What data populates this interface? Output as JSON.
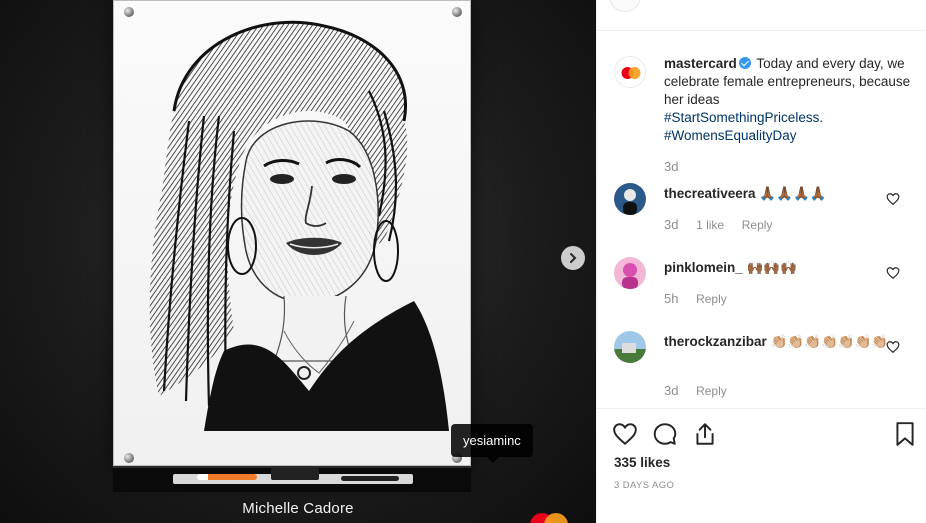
{
  "media": {
    "caption": "Michelle Cadore",
    "tag_label": "yesiaminc",
    "next_icon": "chevron-right-icon"
  },
  "post": {
    "author": "mastercard",
    "caption_text": "Today and every day, we celebrate female entrepreneurs, because her ideas",
    "hashtags": [
      "#StartSomethingPriceless.",
      "#WomensEqualityDay"
    ],
    "time": "3d"
  },
  "comments": [
    {
      "user": "thecreativeera",
      "emoji": "🙏🏾🙏🏾🙏🏾🙏🏾",
      "time": "3d",
      "likes": "1 like",
      "reply": "Reply"
    },
    {
      "user": "pinklomein_",
      "emoji": "🙌🏾🙌🏾🙌🏾",
      "time": "5h",
      "reply": "Reply"
    },
    {
      "user": "therockzanzibar",
      "emoji": "👏🏼👏🏼👏🏼👏🏼👏🏼👏🏼👏🏼",
      "time": "3d",
      "reply": "Reply"
    }
  ],
  "actions": {
    "like_icon": "heart-icon",
    "comment_icon": "comment-icon",
    "share_icon": "share-icon",
    "save_icon": "bookmark-icon"
  },
  "likes": "335 likes",
  "date": "3 DAYS AGO",
  "colors": {
    "link": "#003569",
    "meta": "#8e8e8e",
    "verified": "#3897f0",
    "mc_red": "#eb001b",
    "mc_orange": "#f79e1b"
  }
}
